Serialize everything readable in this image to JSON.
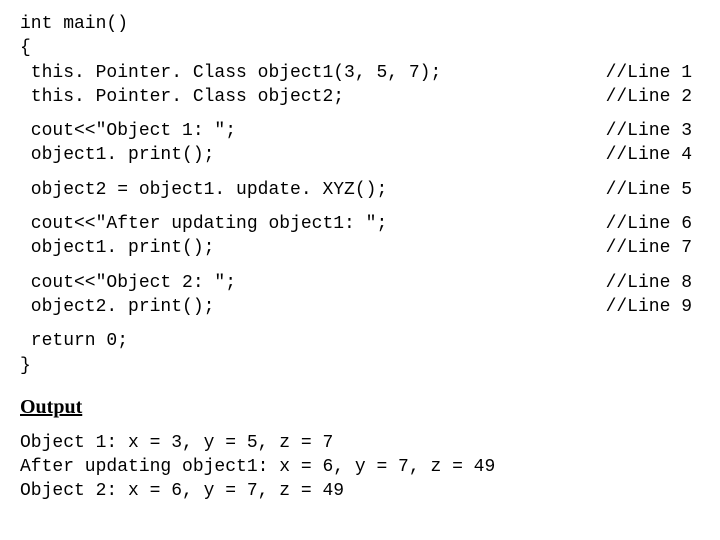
{
  "code": {
    "l0": "int main()",
    "l1": "{",
    "l2": " this. Pointer. Class object1(3, 5, 7);",
    "c2": "//Line 1",
    "l3": " this. Pointer. Class object2;",
    "c3": "//Line 2",
    "l4": " cout<<\"Object 1: \";",
    "c4": "//Line 3",
    "l5": " object1. print();",
    "c5": "//Line 4",
    "l6": " object2 = object1. update. XYZ();",
    "c6": "//Line 5",
    "l7": " cout<<\"After updating object1: \";",
    "c7": "//Line 6",
    "l8": " object1. print();",
    "c8": "//Line 7",
    "l9": " cout<<\"Object 2: \";",
    "c9": "//Line 8",
    "l10": " object2. print();",
    "c10": "//Line 9",
    "l11": " return 0;",
    "l12": "}"
  },
  "heading": "Output",
  "output": {
    "o1": "Object 1: x = 3, y = 5, z = 7",
    "o2": "After updating object1: x = 6, y = 7, z = 49",
    "o3": "Object 2: x = 6, y = 7, z = 49"
  }
}
